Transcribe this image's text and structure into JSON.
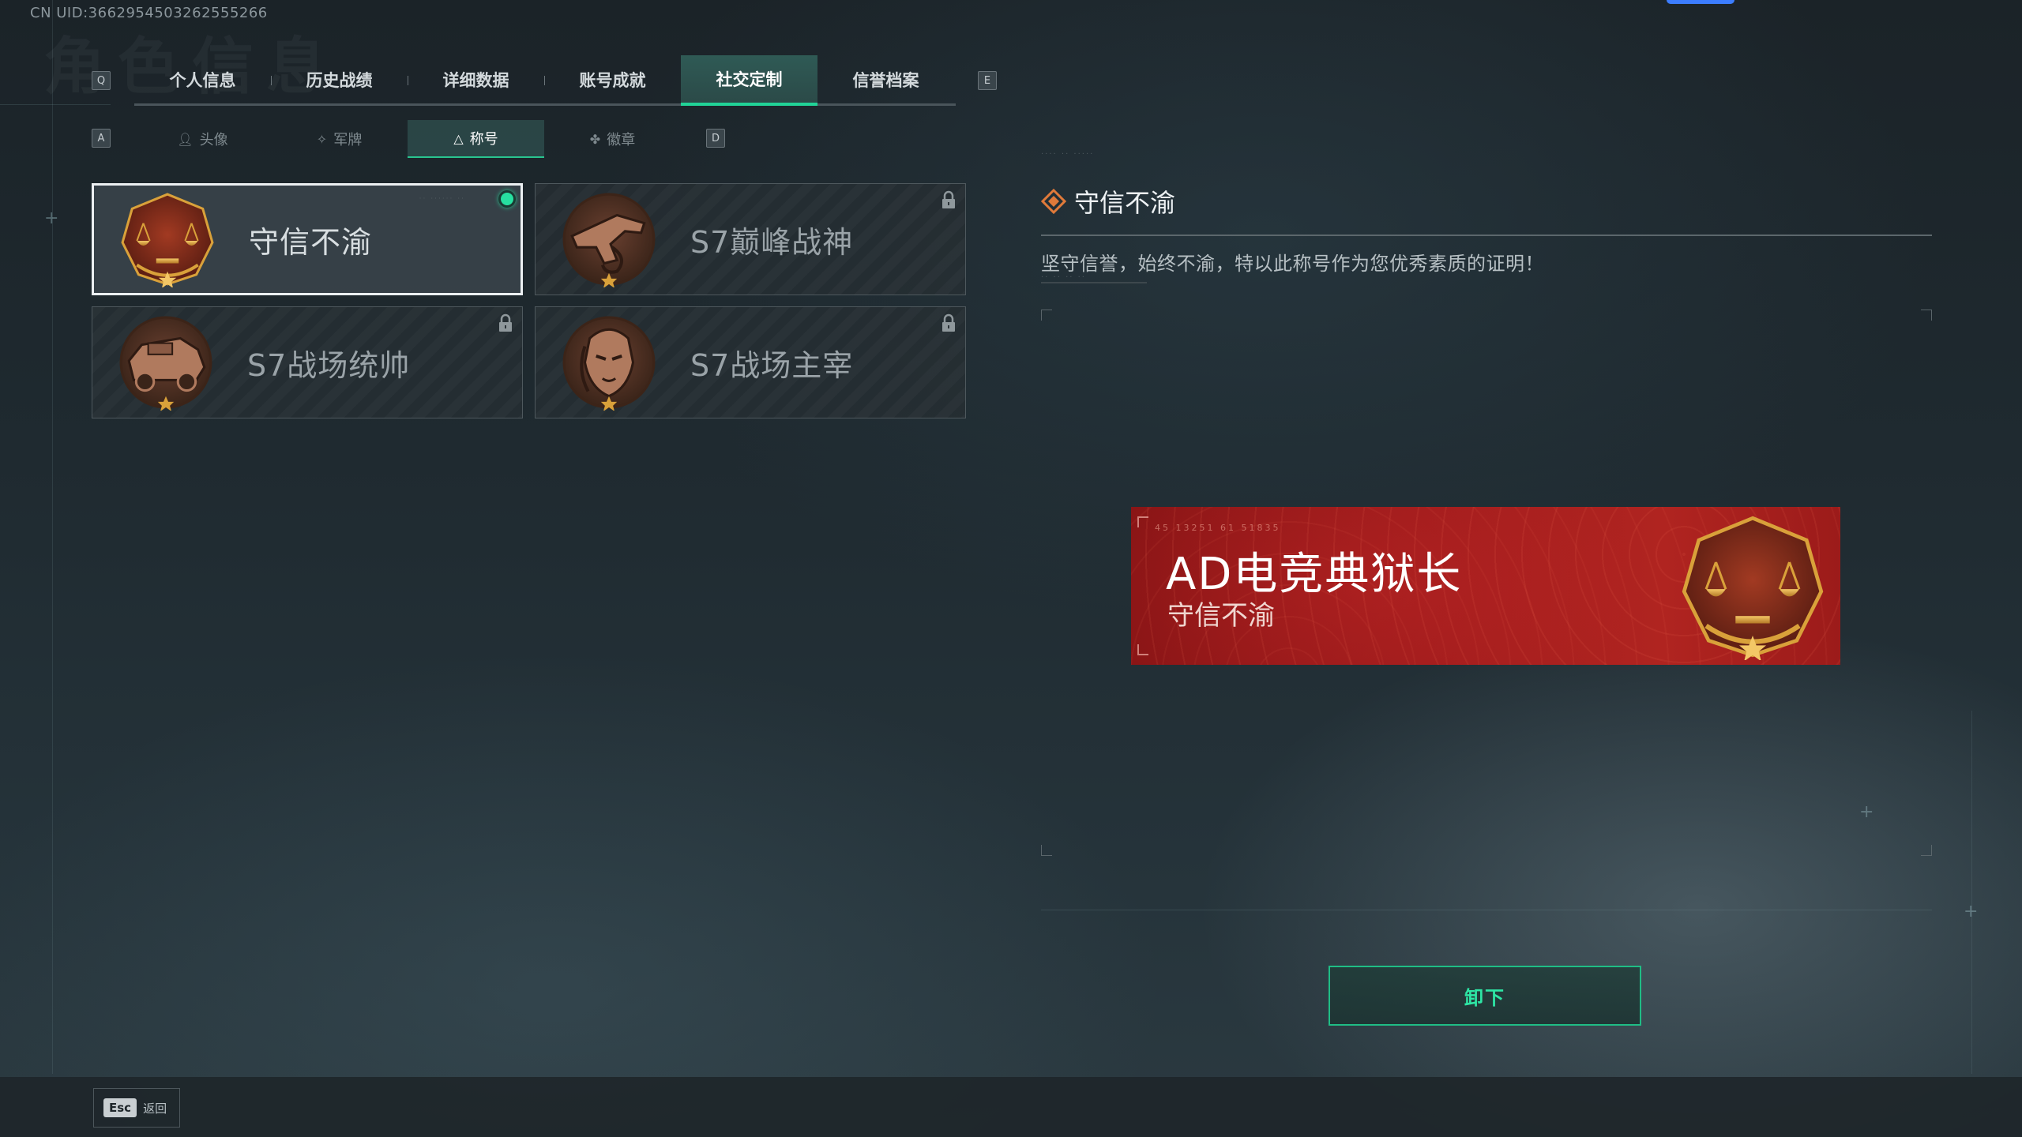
{
  "header": {
    "uid": "CN UID:3662954503262555266",
    "ghost_title": "角色信息"
  },
  "keys": {
    "prev_tab": "Q",
    "next_tab": "E",
    "prev_sub": "A",
    "next_sub": "D"
  },
  "tabs": [
    {
      "label": "个人信息"
    },
    {
      "label": "历史战绩"
    },
    {
      "label": "详细数据"
    },
    {
      "label": "账号成就"
    },
    {
      "label": "社交定制",
      "active": true
    },
    {
      "label": "信誉档案"
    }
  ],
  "subtabs": [
    {
      "label": "头像",
      "icon": "person-icon"
    },
    {
      "label": "军牌",
      "icon": "dogtag-icon"
    },
    {
      "label": "称号",
      "icon": "title-icon",
      "active": true
    },
    {
      "label": "徽章",
      "icon": "badge-icon"
    }
  ],
  "titles": [
    {
      "name": "守信不渝",
      "emblem": "scales-emblem",
      "selected": true,
      "equipped": true,
      "locked": false
    },
    {
      "name": "S7巅峰战神",
      "emblem": "gun-emblem",
      "selected": false,
      "equipped": false,
      "locked": true
    },
    {
      "name": "S7战场统帅",
      "emblem": "vehicle-emblem",
      "selected": false,
      "equipped": false,
      "locked": true
    },
    {
      "name": "S7战场主宰",
      "emblem": "warrior-emblem",
      "selected": false,
      "equipped": false,
      "locked": true
    }
  ],
  "detail": {
    "title": "守信不渝",
    "description": "坚守信誉，始终不渝，特以此称号作为您优秀素质的证明！"
  },
  "banner": {
    "player_name": "AD电竞典狱长",
    "title": "守信不渝",
    "code": "45 13251 61 51835"
  },
  "actions": {
    "unequip": "卸下"
  },
  "footer": {
    "esc_key": "Esc",
    "esc_label": "返回"
  },
  "colors": {
    "accent": "#21d397",
    "banner_red": "#a21d1d",
    "emblem_gold": "#d9a13a",
    "emblem_bg": "#8a2a1c"
  }
}
